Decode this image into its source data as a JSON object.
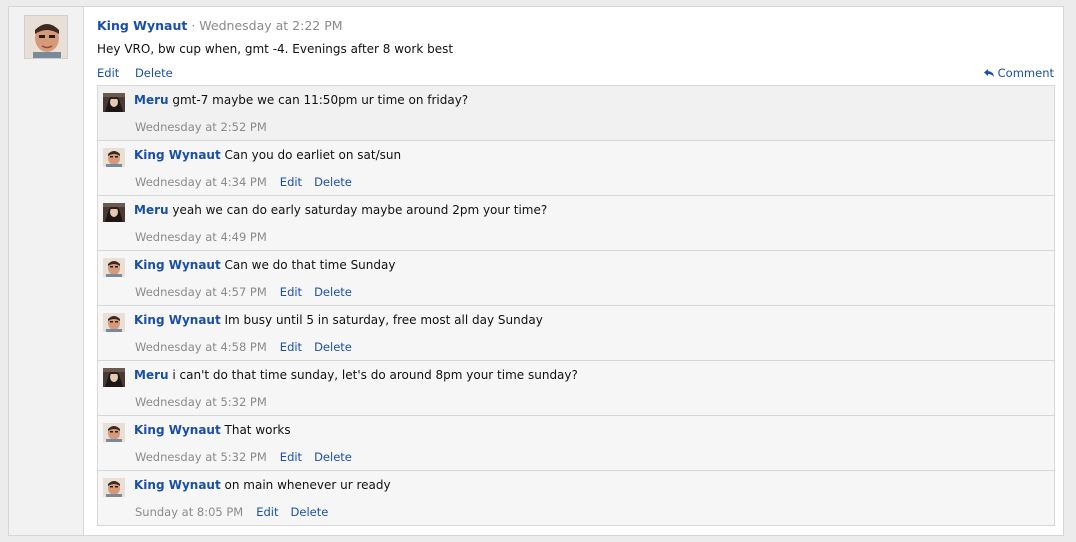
{
  "post": {
    "author": "King Wynaut",
    "separator": "·",
    "time": "Wednesday at 2:22 PM",
    "body": "Hey VRO, bw cup when, gmt -4. Evenings after 8 work best",
    "edit_label": "Edit",
    "delete_label": "Delete",
    "comment_label": "Comment"
  },
  "comments": [
    {
      "author": "Meru",
      "text": "gmt-7 maybe we can 11:50pm ur time on friday?",
      "time": "Wednesday at 2:52 PM",
      "edit": "",
      "delete": "",
      "avatar": "meru-avatar"
    },
    {
      "author": "King Wynaut",
      "text": "Can you do earliet on sat/sun",
      "time": "Wednesday at 4:34 PM",
      "edit": "Edit",
      "delete": "Delete",
      "avatar": "king-avatar"
    },
    {
      "author": "Meru",
      "text": "yeah we can do early saturday maybe around 2pm your time?",
      "time": "Wednesday at 4:49 PM",
      "edit": "",
      "delete": "",
      "avatar": "meru-avatar"
    },
    {
      "author": "King Wynaut",
      "text": "Can we do that time Sunday",
      "time": "Wednesday at 4:57 PM",
      "edit": "Edit",
      "delete": "Delete",
      "avatar": "king-avatar"
    },
    {
      "author": "King Wynaut",
      "text": "Im busy until 5 in saturday, free most all day Sunday",
      "time": "Wednesday at 4:58 PM",
      "edit": "Edit",
      "delete": "Delete",
      "avatar": "king-avatar"
    },
    {
      "author": "Meru",
      "text": "i can't do that time sunday, let's do around 8pm your time sunday?",
      "time": "Wednesday at 5:32 PM",
      "edit": "",
      "delete": "",
      "avatar": "meru-avatar"
    },
    {
      "author": "King Wynaut",
      "text": "That works",
      "time": "Wednesday at 5:32 PM",
      "edit": "Edit",
      "delete": "Delete",
      "avatar": "king-avatar"
    },
    {
      "author": "King Wynaut",
      "text": "on main whenever ur ready",
      "time": "Sunday at 8:05 PM",
      "edit": "Edit",
      "delete": "Delete",
      "avatar": "king-avatar"
    }
  ],
  "colors": {
    "link": "#1a4fa8",
    "muted": "#8a8a8a",
    "comment_bg": "#f6f6f6"
  }
}
